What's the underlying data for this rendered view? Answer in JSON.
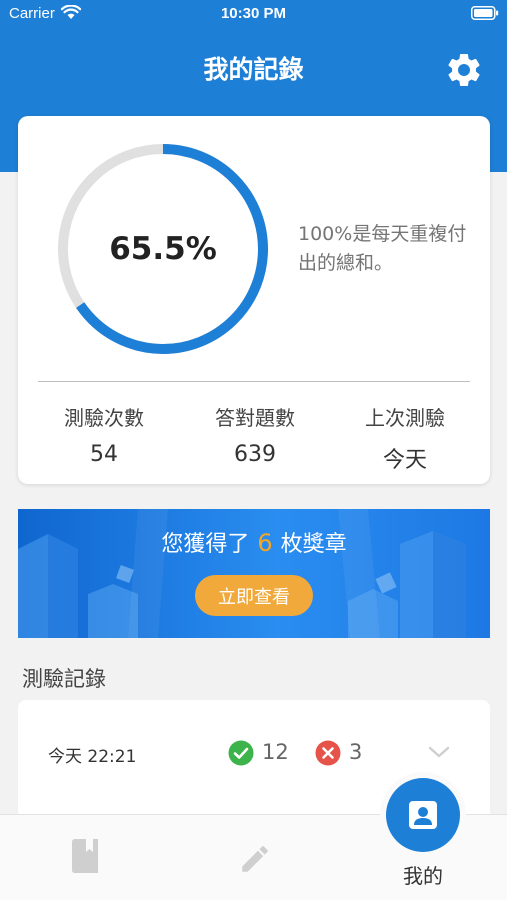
{
  "status_bar": {
    "carrier": "Carrier",
    "time": "10:30 PM"
  },
  "header": {
    "title": "我的記錄"
  },
  "summary": {
    "percent_text": "65.5%",
    "percent_value": 0.655,
    "quote": "100%是每天重複付出的總和。",
    "stats": [
      {
        "label": "測驗次數",
        "value": "54"
      },
      {
        "label": "答對題數",
        "value": "639"
      },
      {
        "label": "上次測驗",
        "value": "今天"
      }
    ]
  },
  "banner": {
    "text_before": "您獲得了",
    "count": "6",
    "text_after": "枚獎章",
    "button_label": "立即查看"
  },
  "records": {
    "title": "測驗記錄",
    "items": [
      {
        "time": "今天 22:21",
        "correct": "12",
        "wrong": "3"
      }
    ]
  },
  "tab_bar": {
    "active_label": "我的"
  },
  "colors": {
    "primary": "#1e7fd6",
    "accent": "#f2a93b",
    "correct": "#3cb44b",
    "wrong": "#e5534b"
  }
}
